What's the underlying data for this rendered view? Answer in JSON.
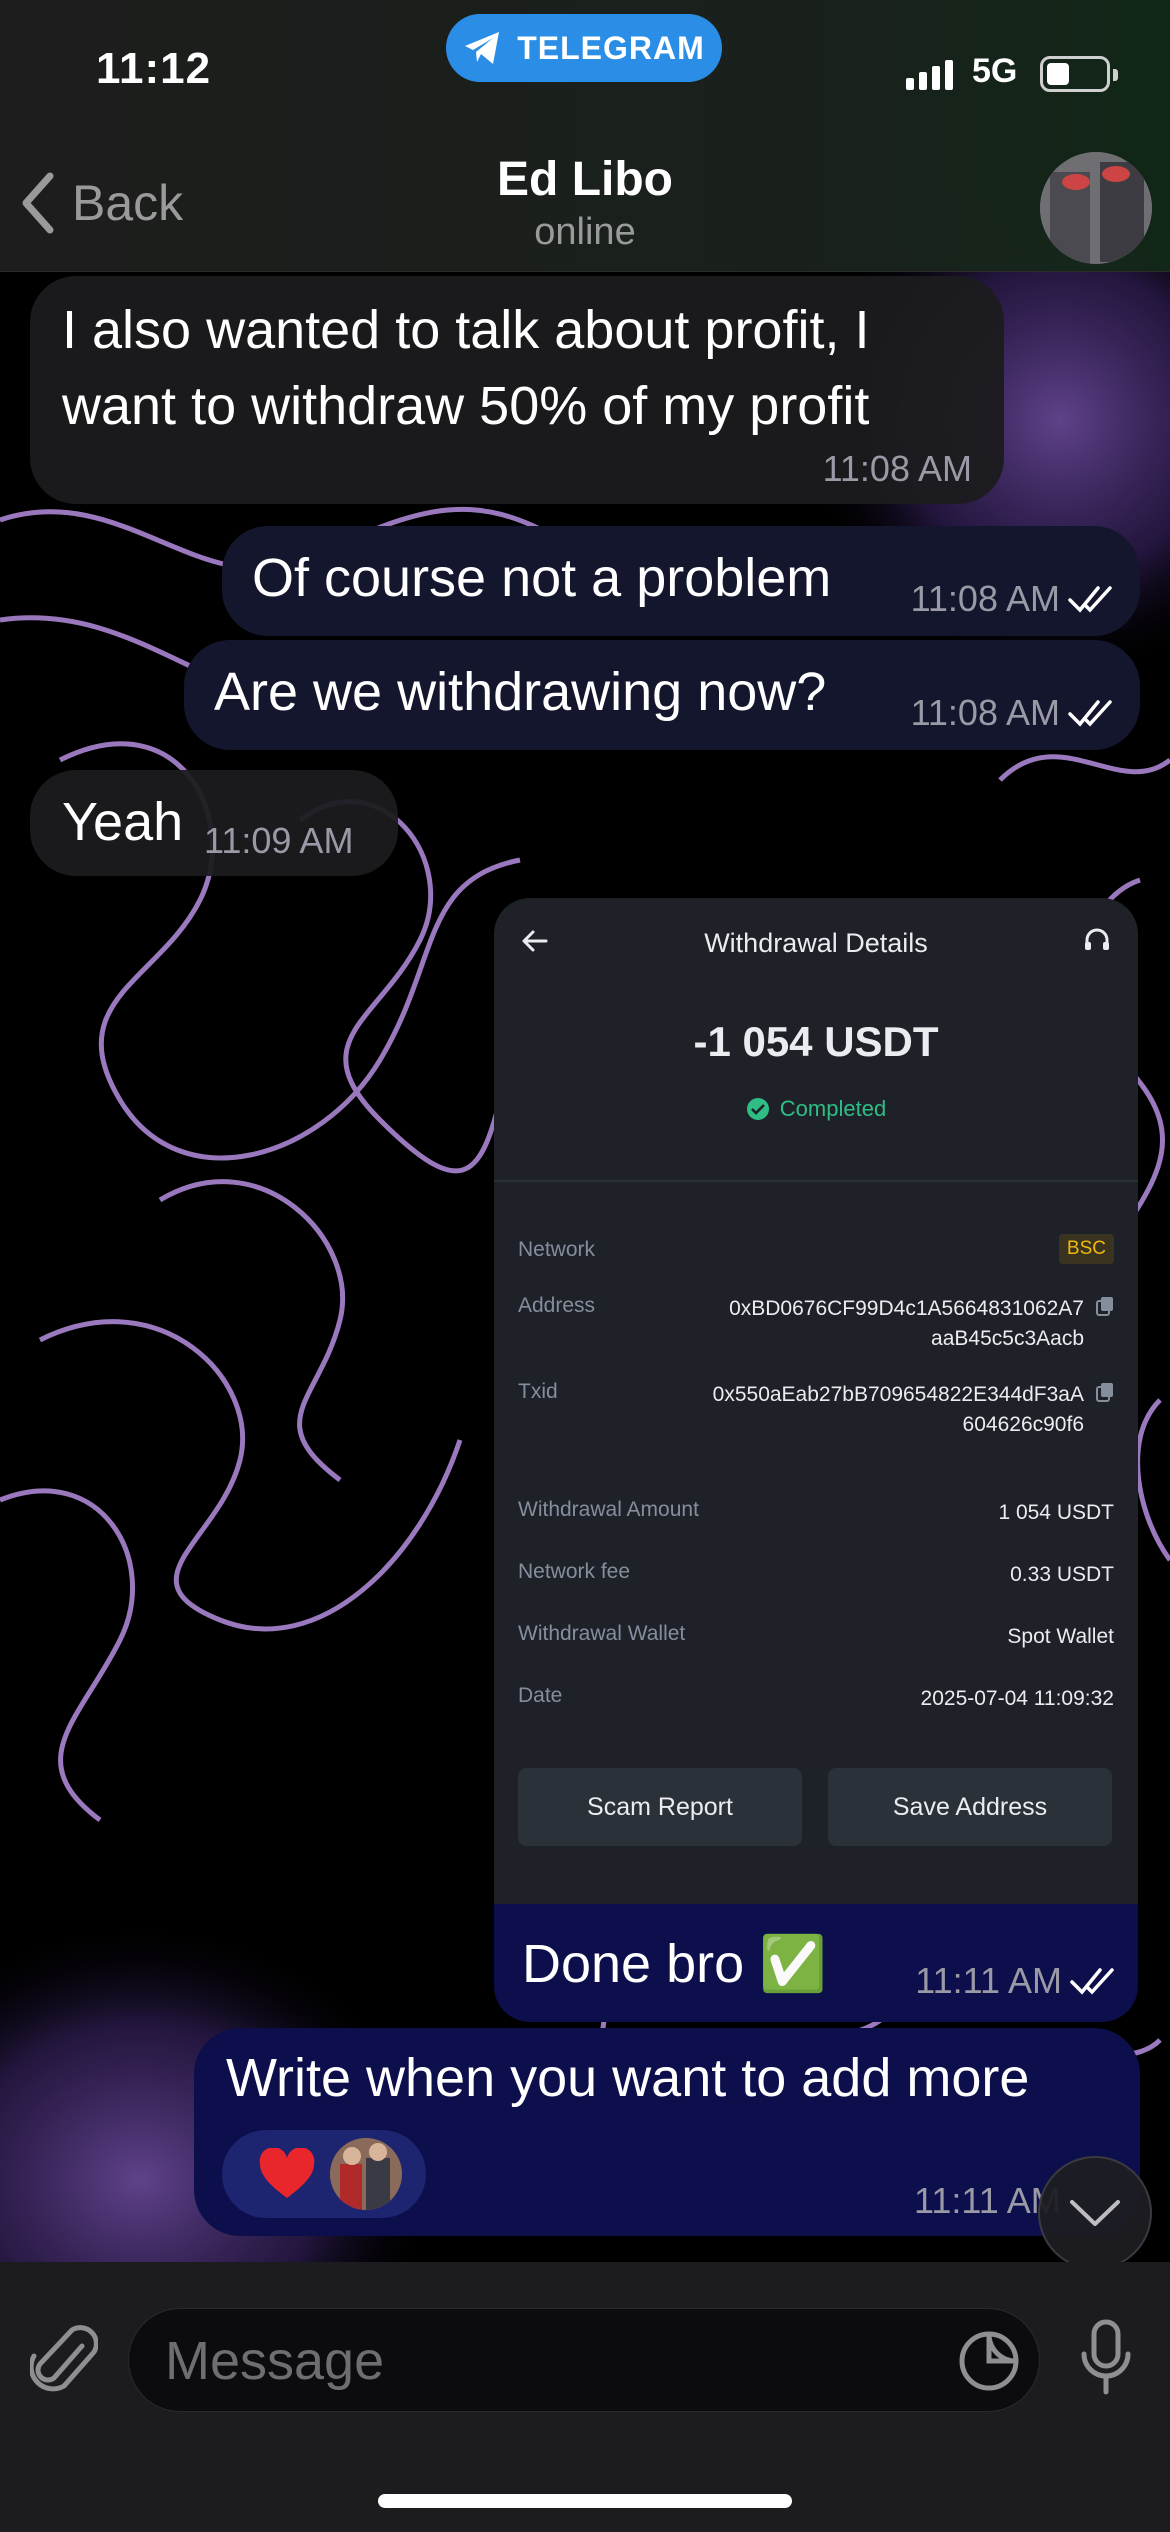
{
  "status_bar": {
    "time": "11:12",
    "app_pill": "TELEGRAM",
    "network": "5G"
  },
  "header": {
    "back_label": "Back",
    "contact_name": "Ed Libo",
    "contact_status": "online"
  },
  "messages": [
    {
      "direction": "in",
      "lines": [
        "I also wanted to talk about profit, I",
        "want to withdraw 50% of my profit"
      ],
      "time": "11:08 AM"
    },
    {
      "direction": "out",
      "text": "Of course not a problem",
      "time": "11:08 AM"
    },
    {
      "direction": "out",
      "text": "Are we withdrawing now?",
      "time": "11:08 AM"
    },
    {
      "direction": "in",
      "text": "Yeah",
      "time": "11:09 AM"
    },
    {
      "direction": "out",
      "caption": "Done bro ✅",
      "time": "11:11 AM"
    },
    {
      "direction": "out",
      "text": "Write when you want to add more",
      "time": "11:11 AM"
    }
  ],
  "withdrawal_card": {
    "title": "Withdrawal Details",
    "amount": "-1 054 USDT",
    "status": "Completed",
    "network_label": "Network",
    "network_value": "BSC",
    "address_label": "Address",
    "address_line1": "0xBD0676CF99D4c1A5664831062A7",
    "address_line2": "aaB45c5c3Aacb",
    "txid_label": "Txid",
    "txid_line1": "0x550aEab27bB709654822E344dF3aA",
    "txid_line2": "604626c90f6",
    "withdrawal_amount_label": "Withdrawal Amount",
    "withdrawal_amount_value": "1 054 USDT",
    "fee_label": "Network fee",
    "fee_value": "0.33 USDT",
    "wallet_label": "Withdrawal Wallet",
    "wallet_value": "Spot Wallet",
    "date_label": "Date",
    "date_value": "2025-07-04 11:09:32",
    "scam_report_button": "Scam Report",
    "save_address_button": "Save Address"
  },
  "reaction": {
    "emoji": "❤️"
  },
  "input": {
    "placeholder": "Message"
  },
  "icons": {
    "back": "chevron-left-icon",
    "telegram": "telegram-icon",
    "attach": "paperclip-icon",
    "sticker": "sticker-icon",
    "mic": "microphone-icon",
    "scroll": "chevron-down-icon",
    "copy": "copy-icon",
    "support": "headset-icon",
    "completed": "check-circle-icon"
  },
  "colors": {
    "outgoing_bubble": "#0d0f4c",
    "incoming_bubble": "#1c1c1e",
    "telegram_blue": "#2a8ee6",
    "completed_green": "#2ebd85",
    "bsc_yellow": "#f0b90b"
  }
}
